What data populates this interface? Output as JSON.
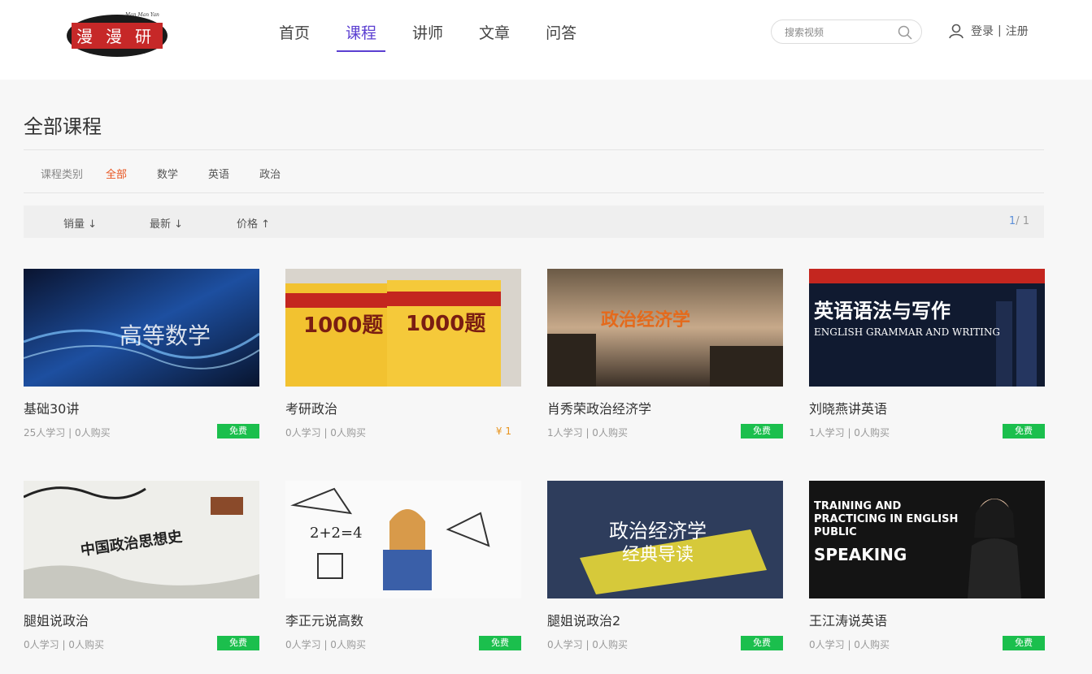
{
  "header": {
    "logo_lettering": "Man Man Yan",
    "nav": [
      "首页",
      "课程",
      "讲师",
      "文章",
      "问答"
    ],
    "active_nav": "课程",
    "search_placeholder": "搜索视频",
    "login": "登录",
    "register": "注册",
    "separator": "|"
  },
  "page": {
    "title": "全部课程",
    "category_label": "课程类别",
    "categories": [
      "全部",
      "数学",
      "英语",
      "政治"
    ],
    "active_category": "全部",
    "sorts": [
      "销量 ↓",
      "最新 ↓",
      "价格 ↑"
    ],
    "pager_current": "1",
    "pager_total": "/ 1"
  },
  "courses": [
    {
      "title": "基础30讲",
      "meta": "25人学习 | 0人购买",
      "tag": "免费",
      "thumb_text": "高等数学"
    },
    {
      "title": "考研政治",
      "meta": "0人学习 | 0人购买",
      "price": "¥ 1",
      "thumb_text": "1000题"
    },
    {
      "title": "肖秀荣政治经济学",
      "meta": "1人学习 | 0人购买",
      "tag": "免费",
      "thumb_text": "政治经济学"
    },
    {
      "title": "刘晓燕讲英语",
      "meta": "1人学习 | 0人购买",
      "tag": "免费",
      "thumb_text": "英语语法与写作",
      "thumb_sub": "ENGLISH GRAMMAR AND WRITING"
    },
    {
      "title": "腿姐说政治",
      "meta": "0人学习 | 0人购买",
      "tag": "免费",
      "thumb_text": "中国政治思想史"
    },
    {
      "title": "李正元说高数",
      "meta": "0人学习 | 0人购买",
      "tag": "免费",
      "thumb_text": "2+2=4"
    },
    {
      "title": "腿姐说政治2",
      "meta": "0人学习 | 0人购买",
      "tag": "免费",
      "thumb_text": "政治经济学",
      "thumb_sub": "经典导读"
    },
    {
      "title": "王江涛说英语",
      "meta": "0人学习 | 0人购买",
      "tag": "免费",
      "thumb_text": "TRAINING AND PRACTICING IN ENGLISH PUBLIC",
      "thumb_sub": "SPEAKING"
    }
  ],
  "colors": {
    "accent": "#5b3fd1",
    "category_active": "#e8541e",
    "free_badge": "#1bbf4d",
    "price": "#e8941e"
  }
}
